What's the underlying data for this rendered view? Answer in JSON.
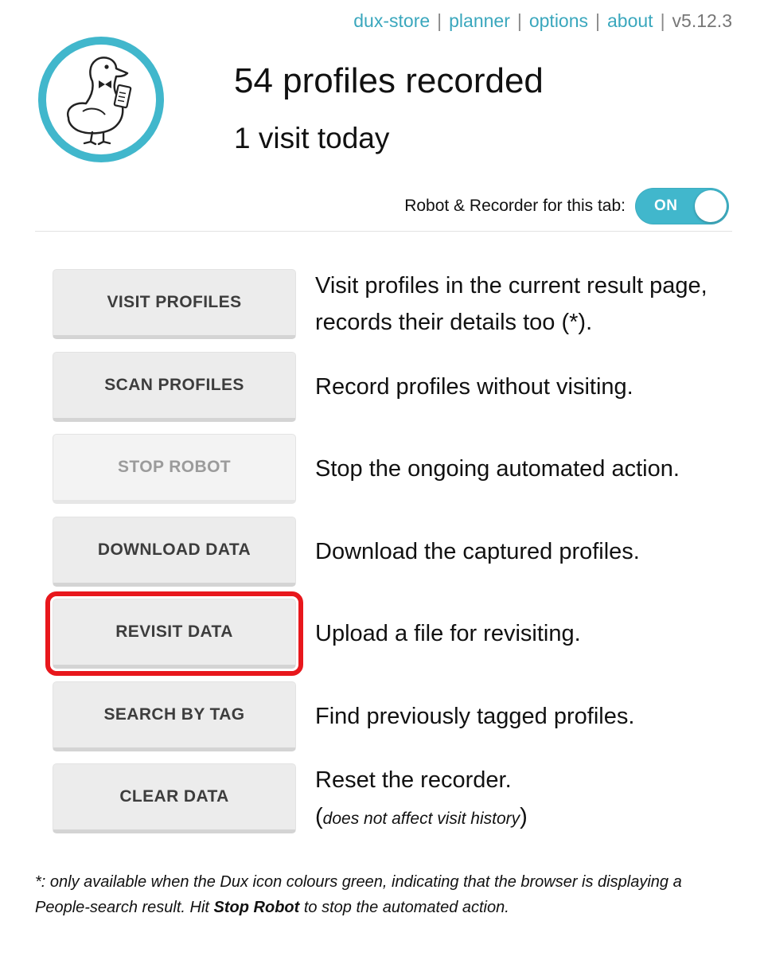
{
  "nav": {
    "links": [
      "dux-store",
      "planner",
      "options",
      "about"
    ],
    "version": "v5.12.3"
  },
  "logo": {
    "icon": "duck-logo-icon",
    "ring_color": "#41b7cc"
  },
  "header": {
    "profiles_recorded": "54 profiles recorded",
    "visits_today": "1 visit today"
  },
  "toggle": {
    "label": "Robot & Recorder for this tab:",
    "state": "ON",
    "color": "#41b7cc"
  },
  "actions": [
    {
      "button": "VISIT PROFILES",
      "description": "Visit profiles in the current result page, records their details too (*).",
      "enabled": true
    },
    {
      "button": "SCAN PROFILES",
      "description": "Record profiles without visiting.",
      "enabled": true
    },
    {
      "button": "STOP ROBOT",
      "description": "Stop the ongoing automated action.",
      "enabled": false
    },
    {
      "button": "DOWNLOAD DATA",
      "description": "Download the captured profiles.",
      "enabled": true
    },
    {
      "button": "REVISIT DATA",
      "description": "Upload a file for revisiting.",
      "enabled": true,
      "highlighted": true,
      "highlight_color": "#e8171c"
    },
    {
      "button": "SEARCH BY TAG",
      "description": "Find previously tagged profiles.",
      "enabled": true
    },
    {
      "button": "CLEAR DATA",
      "description": "Reset the recorder.",
      "note_open": "(",
      "note": "does not affect visit history",
      "note_close": ")",
      "enabled": true
    }
  ],
  "footnote": {
    "part1": "*: only available when the Dux icon colours green, indicating that the browser is displaying a People-search result. Hit ",
    "bold": "Stop Robot",
    "part2": " to stop the automated action."
  }
}
